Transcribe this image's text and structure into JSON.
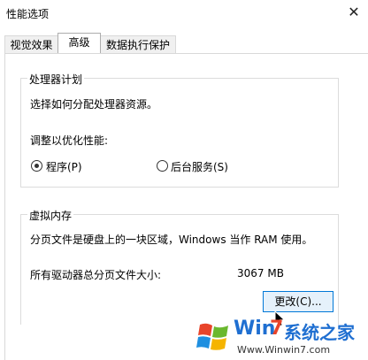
{
  "window": {
    "title": "性能选项",
    "close_icon": "✕"
  },
  "tabs": [
    {
      "label": "视觉效果",
      "active": false
    },
    {
      "label": "高级",
      "active": true
    },
    {
      "label": "数据执行保护",
      "active": false
    }
  ],
  "processor": {
    "group_label": "处理器计划",
    "description": "选择如何分配处理器资源。",
    "optimize_label": "调整以优化性能:",
    "options": [
      {
        "label": "程序(P)",
        "selected": true
      },
      {
        "label": "后台服务(S)",
        "selected": false
      }
    ]
  },
  "virtual_memory": {
    "group_label": "虚拟内存",
    "description": "分页文件是硬盘上的一块区域，Windows 当作 RAM 使用。",
    "total_label": "所有驱动器总分页文件大小:",
    "total_value": "3067 MB",
    "change_button": "更改(C)..."
  },
  "watermark": {
    "brand": "Win7系统之家",
    "brand_win": "Win",
    "brand_7": "7",
    "brand_cn": "系统之家",
    "url": "Www.Winwin7.com"
  }
}
